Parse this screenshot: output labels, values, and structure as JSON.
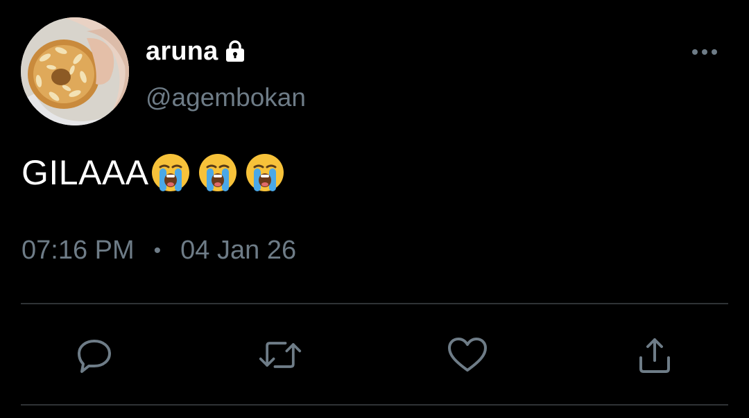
{
  "user": {
    "display_name": "aruna",
    "handle": "@agembokan",
    "protected_icon": "lock-icon",
    "avatar_icon": "donut-photo"
  },
  "tweet": {
    "text": "GILAAA",
    "emojis": [
      "loudly-crying-face",
      "loudly-crying-face",
      "loudly-crying-face"
    ],
    "time": "07:16 PM",
    "separator": "•",
    "date": "04 Jan 26"
  },
  "actions": [
    {
      "name": "reply",
      "icon": "reply-icon"
    },
    {
      "name": "retweet",
      "icon": "retweet-icon"
    },
    {
      "name": "like",
      "icon": "heart-icon"
    },
    {
      "name": "share",
      "icon": "share-icon"
    }
  ],
  "colors": {
    "background": "#000000",
    "primary_text": "#ffffff",
    "secondary_text": "#6e7c87",
    "divider": "#2f3336"
  }
}
